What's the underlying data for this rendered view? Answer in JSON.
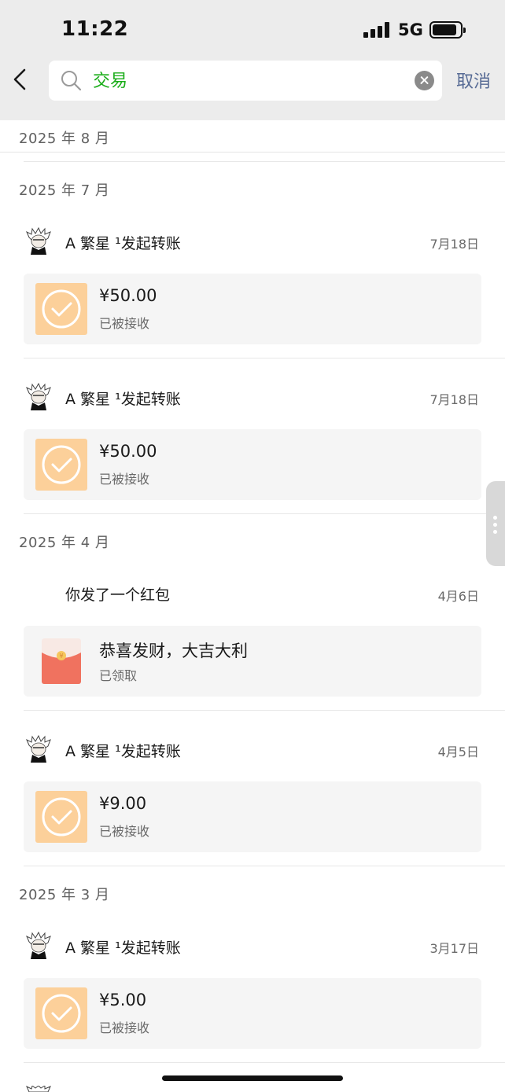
{
  "status_bar": {
    "time": "11:22",
    "network": "5G"
  },
  "search": {
    "query": "交易",
    "cancel_label": "取消"
  },
  "months": {
    "aug": "2025 年 8 月",
    "jul": "2025 年 7 月",
    "apr": "2025 年 4 月",
    "mar": "2025 年 3 月"
  },
  "records": [
    {
      "sender": "A 繁星 ¹发起转账",
      "date": "7月18日",
      "amount": "¥50.00",
      "status": "已被接收"
    },
    {
      "sender": "A 繁星 ¹发起转账",
      "date": "7月18日",
      "amount": "¥50.00",
      "status": "已被接收"
    },
    {
      "sender": "你发了一个红包",
      "date": "4月6日",
      "amount": "恭喜发财，大吉大利",
      "status": "已领取"
    },
    {
      "sender": "A 繁星 ¹发起转账",
      "date": "4月5日",
      "amount": "¥9.00",
      "status": "已被接收"
    },
    {
      "sender": "A 繁星 ¹发起转账",
      "date": "3月17日",
      "amount": "¥5.00",
      "status": "已被接收"
    }
  ],
  "colors": {
    "accent_green": "#1aad19",
    "link_blue": "#576b95",
    "transfer_orange": "#fcd09a",
    "red_packet": "#f0725f"
  }
}
